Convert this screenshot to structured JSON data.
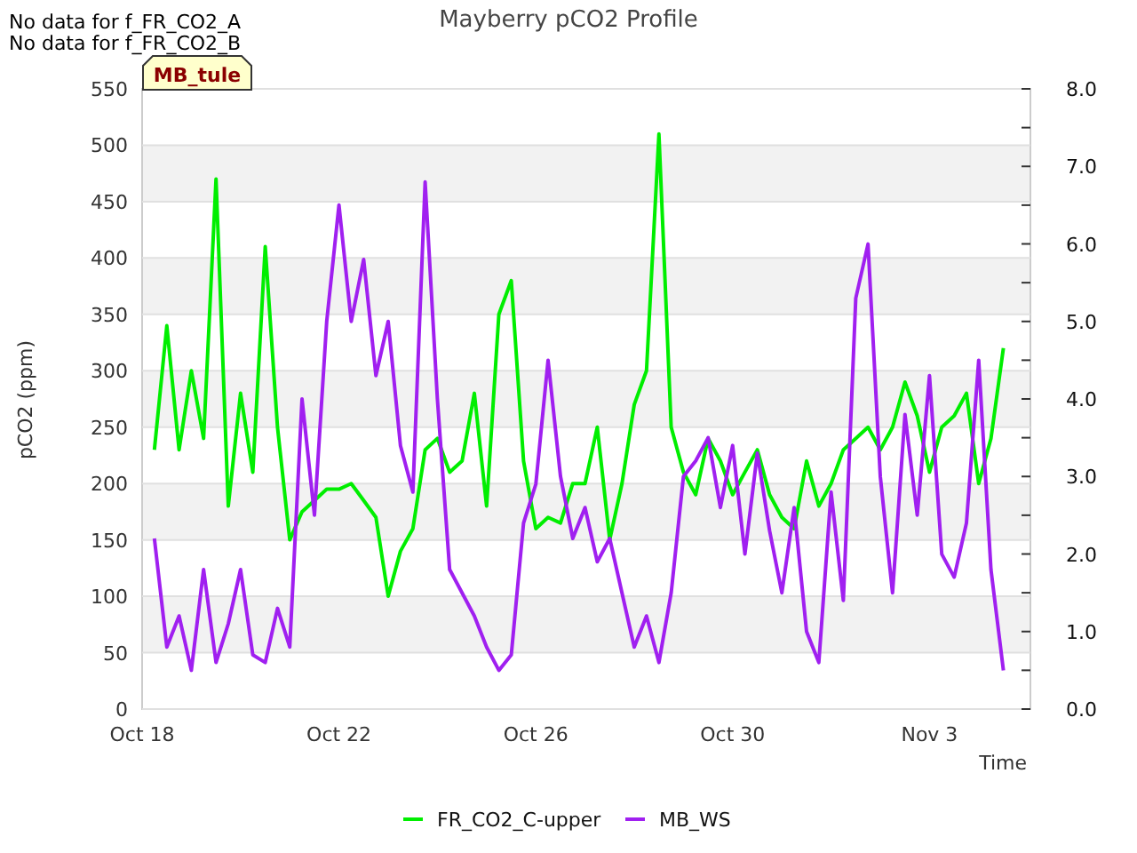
{
  "notices": [
    "No data for f_FR_CO2_A",
    "No data for f_FR_CO2_B"
  ],
  "site_tag": "MB_tule",
  "chart_data": {
    "type": "line",
    "title": "Mayberry pCO2 Profile",
    "xlabel": "Time",
    "ylabel": "pCO2 (ppm)",
    "categories": [
      "Oct 18",
      null,
      null,
      null,
      null,
      null,
      null,
      null,
      null,
      null,
      null,
      null,
      null,
      null,
      null,
      null,
      "Oct 22",
      null,
      null,
      null,
      null,
      null,
      null,
      null,
      null,
      null,
      null,
      null,
      null,
      null,
      null,
      null,
      "Oct 26",
      null,
      null,
      null,
      null,
      null,
      null,
      null,
      null,
      null,
      null,
      null,
      null,
      null,
      null,
      null,
      "Oct 30",
      null,
      null,
      null,
      null,
      null,
      null,
      null,
      null,
      null,
      null,
      null,
      null,
      null,
      null,
      null,
      "Nov 3",
      null,
      null,
      null,
      null,
      null,
      null
    ],
    "grid": true,
    "legend": "bottom",
    "ylim": [
      0,
      550
    ],
    "yticks": [
      0,
      50,
      100,
      150,
      200,
      250,
      300,
      350,
      400,
      450,
      500,
      550
    ],
    "y2lim": [
      0,
      8
    ],
    "y2ticks": [
      {
        "value": 0,
        "label": "0.0"
      },
      {
        "value": 1,
        "label": "1.0"
      },
      {
        "value": 2,
        "label": "2.0"
      },
      {
        "value": 3,
        "label": "3.0"
      },
      {
        "value": 4,
        "label": "4.0"
      },
      {
        "value": 5,
        "label": "5.0"
      },
      {
        "value": 6,
        "label": "6.0"
      },
      {
        "value": 7,
        "label": "7.0"
      },
      {
        "value": 8,
        "label": "8.0"
      }
    ],
    "series": [
      {
        "name": "FR_CO2_C-upper",
        "color": "#00ee00",
        "values": [
          null,
          230,
          340,
          230,
          300,
          240,
          470,
          180,
          280,
          210,
          410,
          250,
          150,
          175,
          185,
          195,
          195,
          200,
          185,
          170,
          100,
          140,
          160,
          230,
          240,
          210,
          220,
          280,
          180,
          350,
          380,
          220,
          160,
          170,
          165,
          200,
          200,
          250,
          150,
          200,
          270,
          300,
          510,
          250,
          210,
          190,
          240,
          220,
          190,
          210,
          230,
          190,
          170,
          160,
          220,
          180,
          200,
          230,
          240,
          250,
          230,
          250,
          290,
          260,
          210,
          250,
          260,
          280,
          200,
          240,
          320
        ]
      },
      {
        "name": "MB_WS",
        "color": "#a020f0",
        "axis": "y2",
        "values": [
          null,
          2.2,
          0.8,
          1.2,
          0.5,
          1.8,
          0.6,
          1.1,
          1.8,
          0.7,
          0.6,
          1.3,
          0.8,
          4.0,
          2.5,
          5.0,
          6.5,
          5.0,
          5.8,
          4.3,
          5.0,
          3.4,
          2.8,
          6.8,
          4.0,
          1.8,
          1.5,
          1.2,
          0.8,
          0.5,
          0.7,
          2.4,
          2.9,
          4.5,
          3.0,
          2.2,
          2.6,
          1.9,
          2.2,
          1.5,
          0.8,
          1.2,
          0.6,
          1.5,
          3.0,
          3.2,
          3.5,
          2.6,
          3.4,
          2.0,
          3.3,
          2.3,
          1.5,
          2.6,
          1.0,
          0.6,
          2.8,
          1.4,
          5.3,
          6.0,
          3.0,
          1.5,
          3.8,
          2.5,
          4.3,
          2.0,
          1.7,
          2.4,
          4.5,
          1.8,
          0.5
        ]
      }
    ]
  }
}
